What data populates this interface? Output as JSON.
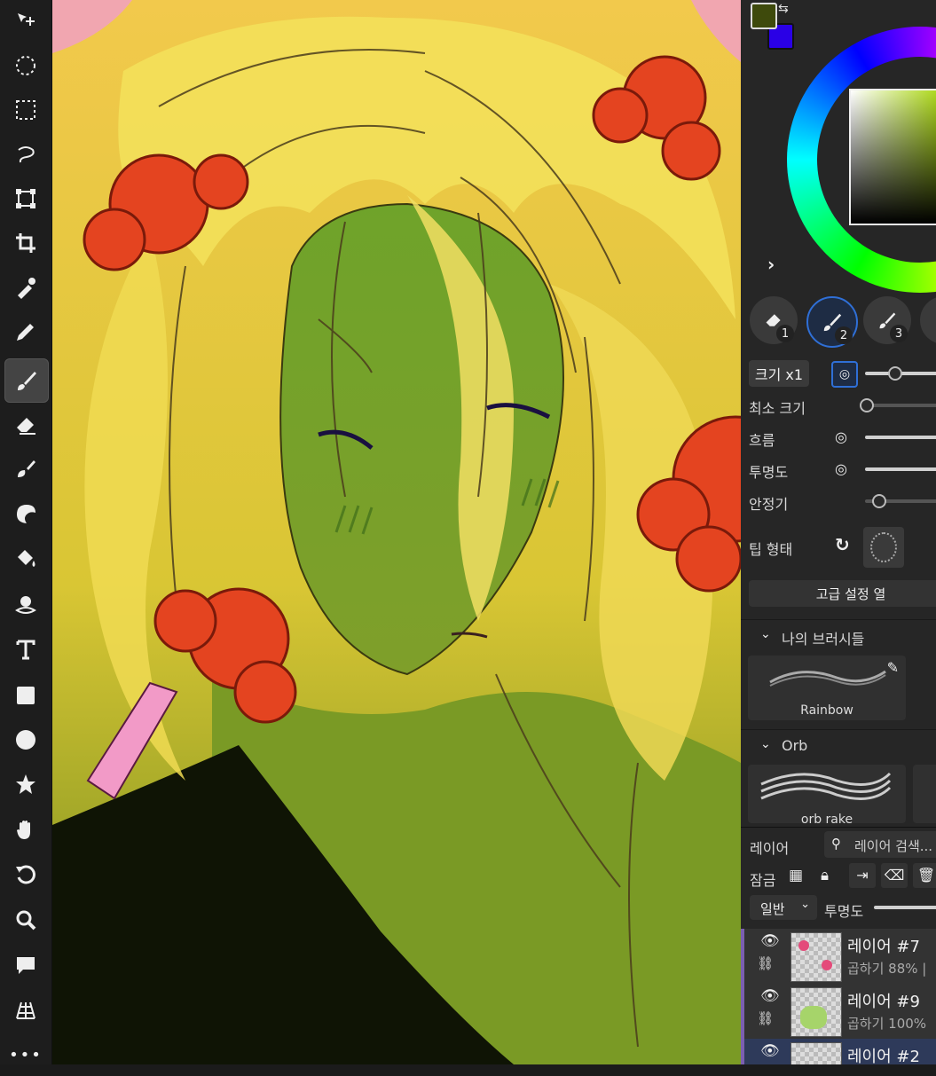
{
  "colors": {
    "primary": "#3e4a0c",
    "secondary": "#2a00e6",
    "accent": "#2f6fd6",
    "layer_marker": "#7b5fb0"
  },
  "toolbar": {
    "tools": [
      "move-icon",
      "lasso-ellipse-icon",
      "marquee-icon",
      "lasso-icon",
      "transform-icon",
      "crop-icon",
      "eyedropper-icon",
      "pen-icon",
      "brush-icon",
      "eraser-icon",
      "smudge-icon",
      "blur-icon",
      "fill-icon",
      "magic-wand-icon",
      "text-icon",
      "rectangle-icon",
      "ellipse-icon",
      "star-icon",
      "hand-icon",
      "undo-icon",
      "zoom-icon",
      "comment-icon",
      "perspective-icon",
      "more-icon"
    ],
    "active": "brush-icon",
    "more": "•••"
  },
  "brush_panel": {
    "slots": [
      "1",
      "2",
      "3"
    ],
    "size_label": "크기 x1",
    "min_size_label": "최소 크기",
    "flow_label": "흐름",
    "opacity_label": "투명도",
    "stabilizer_label": "안정기",
    "tip_label": "팁 형태",
    "advanced_button": "고급 설정 열",
    "size_level": 0.35,
    "min_size_level": 0.0,
    "stabilizer_level": 0.15
  },
  "brush_library": {
    "my_brushes_header": "나의 브러시들",
    "my_brushes": [
      {
        "name": "Rainbow"
      }
    ],
    "orb_header": "Orb",
    "orb_brushes": [
      {
        "name": "orb rake"
      }
    ]
  },
  "layers_panel": {
    "title": "레이어",
    "search_placeholder": "레이어 검색...",
    "lock_label": "잠금",
    "blend_mode": "일반",
    "opacity_label": "투명도",
    "layers": [
      {
        "name": "레이어 #7",
        "info": "곱하기 88% |"
      },
      {
        "name": "레이어 #9",
        "info": "곱하기 100%"
      },
      {
        "name": "레이어 #2",
        "info": ""
      }
    ]
  }
}
